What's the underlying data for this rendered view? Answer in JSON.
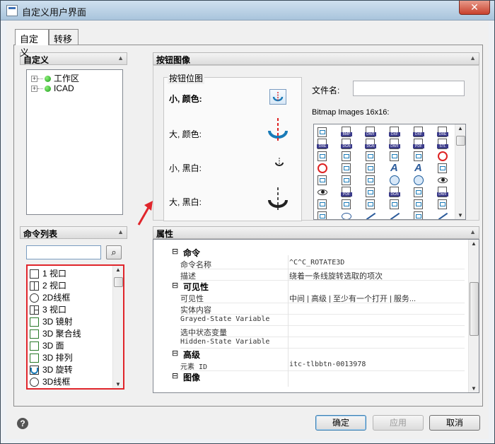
{
  "window": {
    "title": "自定义用户界面",
    "close_glyph": "✕"
  },
  "tabs": [
    {
      "label": "自定义"
    },
    {
      "label": "转移"
    }
  ],
  "customize": {
    "title": "自定义",
    "tree": [
      {
        "label": "工作区"
      },
      {
        "label": "ICAD"
      }
    ]
  },
  "command_list": {
    "title": "命令列表",
    "search_value": "",
    "items": [
      {
        "label": "1 视口",
        "icon": "single-viewport-icon"
      },
      {
        "label": "2 视口",
        "icon": "two-viewports-icon"
      },
      {
        "label": "2D线框",
        "icon": "2d-wireframe-icon"
      },
      {
        "label": "3 视口",
        "icon": "three-viewports-icon"
      },
      {
        "label": "3D 镜射",
        "icon": "3d-mirror-icon"
      },
      {
        "label": "3D 聚合线",
        "icon": "3d-polyline-icon"
      },
      {
        "label": "3D 面",
        "icon": "3d-face-icon"
      },
      {
        "label": "3D 排列",
        "icon": "3d-array-icon"
      },
      {
        "label": "3D 旋转",
        "icon": "3d-rotate-icon"
      },
      {
        "label": "3D线框",
        "icon": "3d-wireframe-icon"
      }
    ]
  },
  "button_image": {
    "title": "按钮图像",
    "group_title": "按钮位图",
    "sizes": [
      {
        "label": "小, 颜色:"
      },
      {
        "label": "大, 颜色:"
      },
      {
        "label": "小, 黑白:"
      },
      {
        "label": "大, 黑白:"
      }
    ],
    "filename_label": "文件名:",
    "filename_value": "",
    "bitmap_label": "Bitmap Images 16x16:",
    "icon_rows": [
      [
        "flask",
        "BMP",
        "DWF",
        "DXF",
        "DXF",
        "DRE"
      ],
      [
        "DRE",
        "DGN",
        "DGN",
        "DWF",
        "PDF",
        "STL"
      ],
      [
        "check",
        "table",
        "grid",
        "grid",
        "grid",
        "ban"
      ],
      [
        "ban",
        "ruler",
        "grid",
        "A",
        "A",
        "doc"
      ],
      [
        "doc",
        "doc",
        "doc",
        "globe",
        "globe",
        "eye"
      ],
      [
        "eye",
        "PDF",
        "doc",
        "DGN",
        "doc",
        "DWF"
      ],
      [
        "doc",
        "doc",
        "doc",
        "doc",
        "doc",
        "doc"
      ],
      [
        "frame",
        "ellipse",
        "line",
        "curve",
        "poly",
        "pencil"
      ]
    ]
  },
  "properties": {
    "title": "属性",
    "rows": [
      {
        "kind": "cat",
        "label": "命令",
        "toggle": "⊟"
      },
      {
        "kind": "prop",
        "name": "命令名称",
        "value": "^C^C_ROTATE3D",
        "mono_value": true
      },
      {
        "kind": "prop",
        "name": "描述",
        "value": "绕着一条线旋转选取的项次"
      },
      {
        "kind": "cat",
        "label": "可见性",
        "toggle": "⊟"
      },
      {
        "kind": "prop",
        "name": "可见性",
        "value": "中间 | 高级 | 至少有一个打开 | 服务..."
      },
      {
        "kind": "prop",
        "name": "实体内容",
        "value": ""
      },
      {
        "kind": "prop",
        "name": "Grayed-State Variable",
        "value": "",
        "mono_name": true
      },
      {
        "kind": "prop",
        "name": "选中状态变量",
        "value": ""
      },
      {
        "kind": "prop",
        "name": "Hidden-State Variable",
        "value": "",
        "mono_name": true
      },
      {
        "kind": "cat",
        "label": "高级",
        "toggle": "⊟"
      },
      {
        "kind": "prop",
        "name": "元素 ID",
        "value": "itc-tlbbtn-0013978",
        "mono_value": true,
        "mono_name": true
      },
      {
        "kind": "cat",
        "label": "图像",
        "toggle": "⊟"
      }
    ]
  },
  "footer": {
    "help_glyph": "?",
    "ok": "确定",
    "apply": "应用",
    "cancel": "取消"
  },
  "colors": {
    "highlight_red": "#e0252b",
    "accent_blue": "#1a7bb8"
  }
}
